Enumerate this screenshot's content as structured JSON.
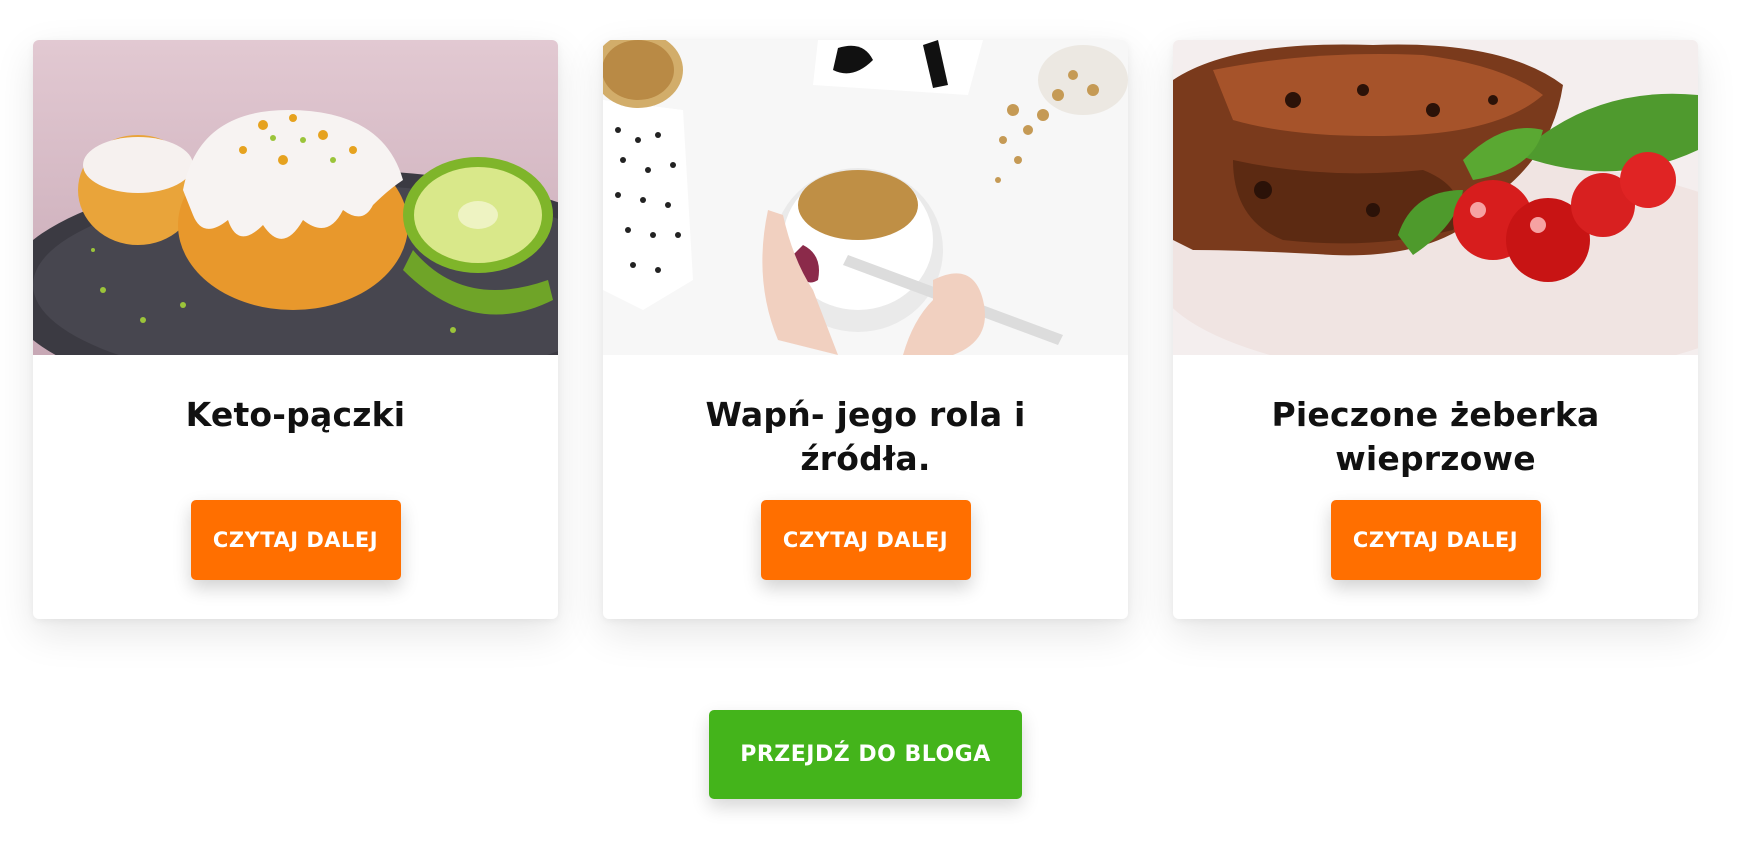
{
  "posts": [
    {
      "title": "Keto-pączki",
      "image": "glazed-keto-muffins-with-lime",
      "button_label": "CZYTAJ DALEJ"
    },
    {
      "title": "Wapń- jego rola i źródła.",
      "image": "yogurt-bowl-with-granola",
      "button_label": "CZYTAJ DALEJ"
    },
    {
      "title": "Pieczone żeberka wieprzowe",
      "image": "roasted-pork-ribs-with-tomatoes-and-basil",
      "button_label": "CZYTAJ DALEJ"
    }
  ],
  "blog_button": {
    "label": "PRZEJDŹ DO BLOGA"
  },
  "colors": {
    "read_more": "#ff6f00",
    "blog_button": "#44b41b"
  }
}
